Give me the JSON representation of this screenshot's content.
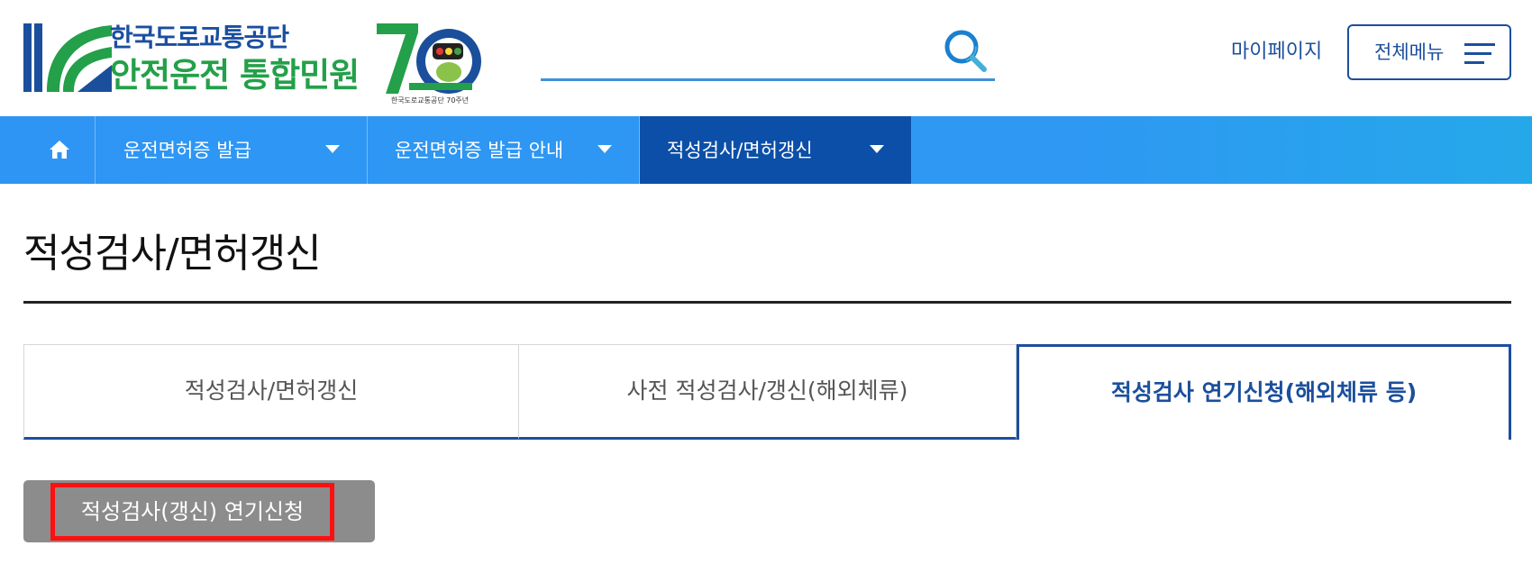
{
  "header": {
    "logo_line1": "한국도로교통공단",
    "logo_line2": "안전운전 통합민원",
    "anniversary_caption": "한국도로교통공단 70주년",
    "search_placeholder": "",
    "mypage_label": "마이페이지",
    "allmenu_label": "전체메뉴"
  },
  "nav": {
    "items": [
      {
        "label": "운전면허증 발급",
        "active": false
      },
      {
        "label": "운전면허증 발급 안내",
        "active": false
      },
      {
        "label": "적성검사/면허갱신",
        "active": true
      }
    ]
  },
  "main": {
    "page_title": "적성검사/면허갱신",
    "tabs": [
      {
        "label": "적성검사/면허갱신",
        "selected": false
      },
      {
        "label": "사전 적성검사/갱신(해외체류)",
        "selected": false
      },
      {
        "label": "적성검사 연기신청(해외체류 등)",
        "selected": true
      }
    ],
    "apply_button_label": "적성검사(갱신) 연기신청"
  },
  "colors": {
    "brand_blue": "#1b4f9c",
    "brand_green": "#23a049",
    "nav_blue": "#2e95f4",
    "nav_active": "#0c4fa8",
    "highlight_red": "#ff1010",
    "button_gray": "#8c8c8c"
  },
  "icons": {
    "logo": "kororoad-k-logo",
    "anniversary": "70th-anniversary-emblem",
    "search": "search-icon",
    "menu": "hamburger-menu-icon",
    "home": "home-icon",
    "caret": "caret-down-icon"
  }
}
